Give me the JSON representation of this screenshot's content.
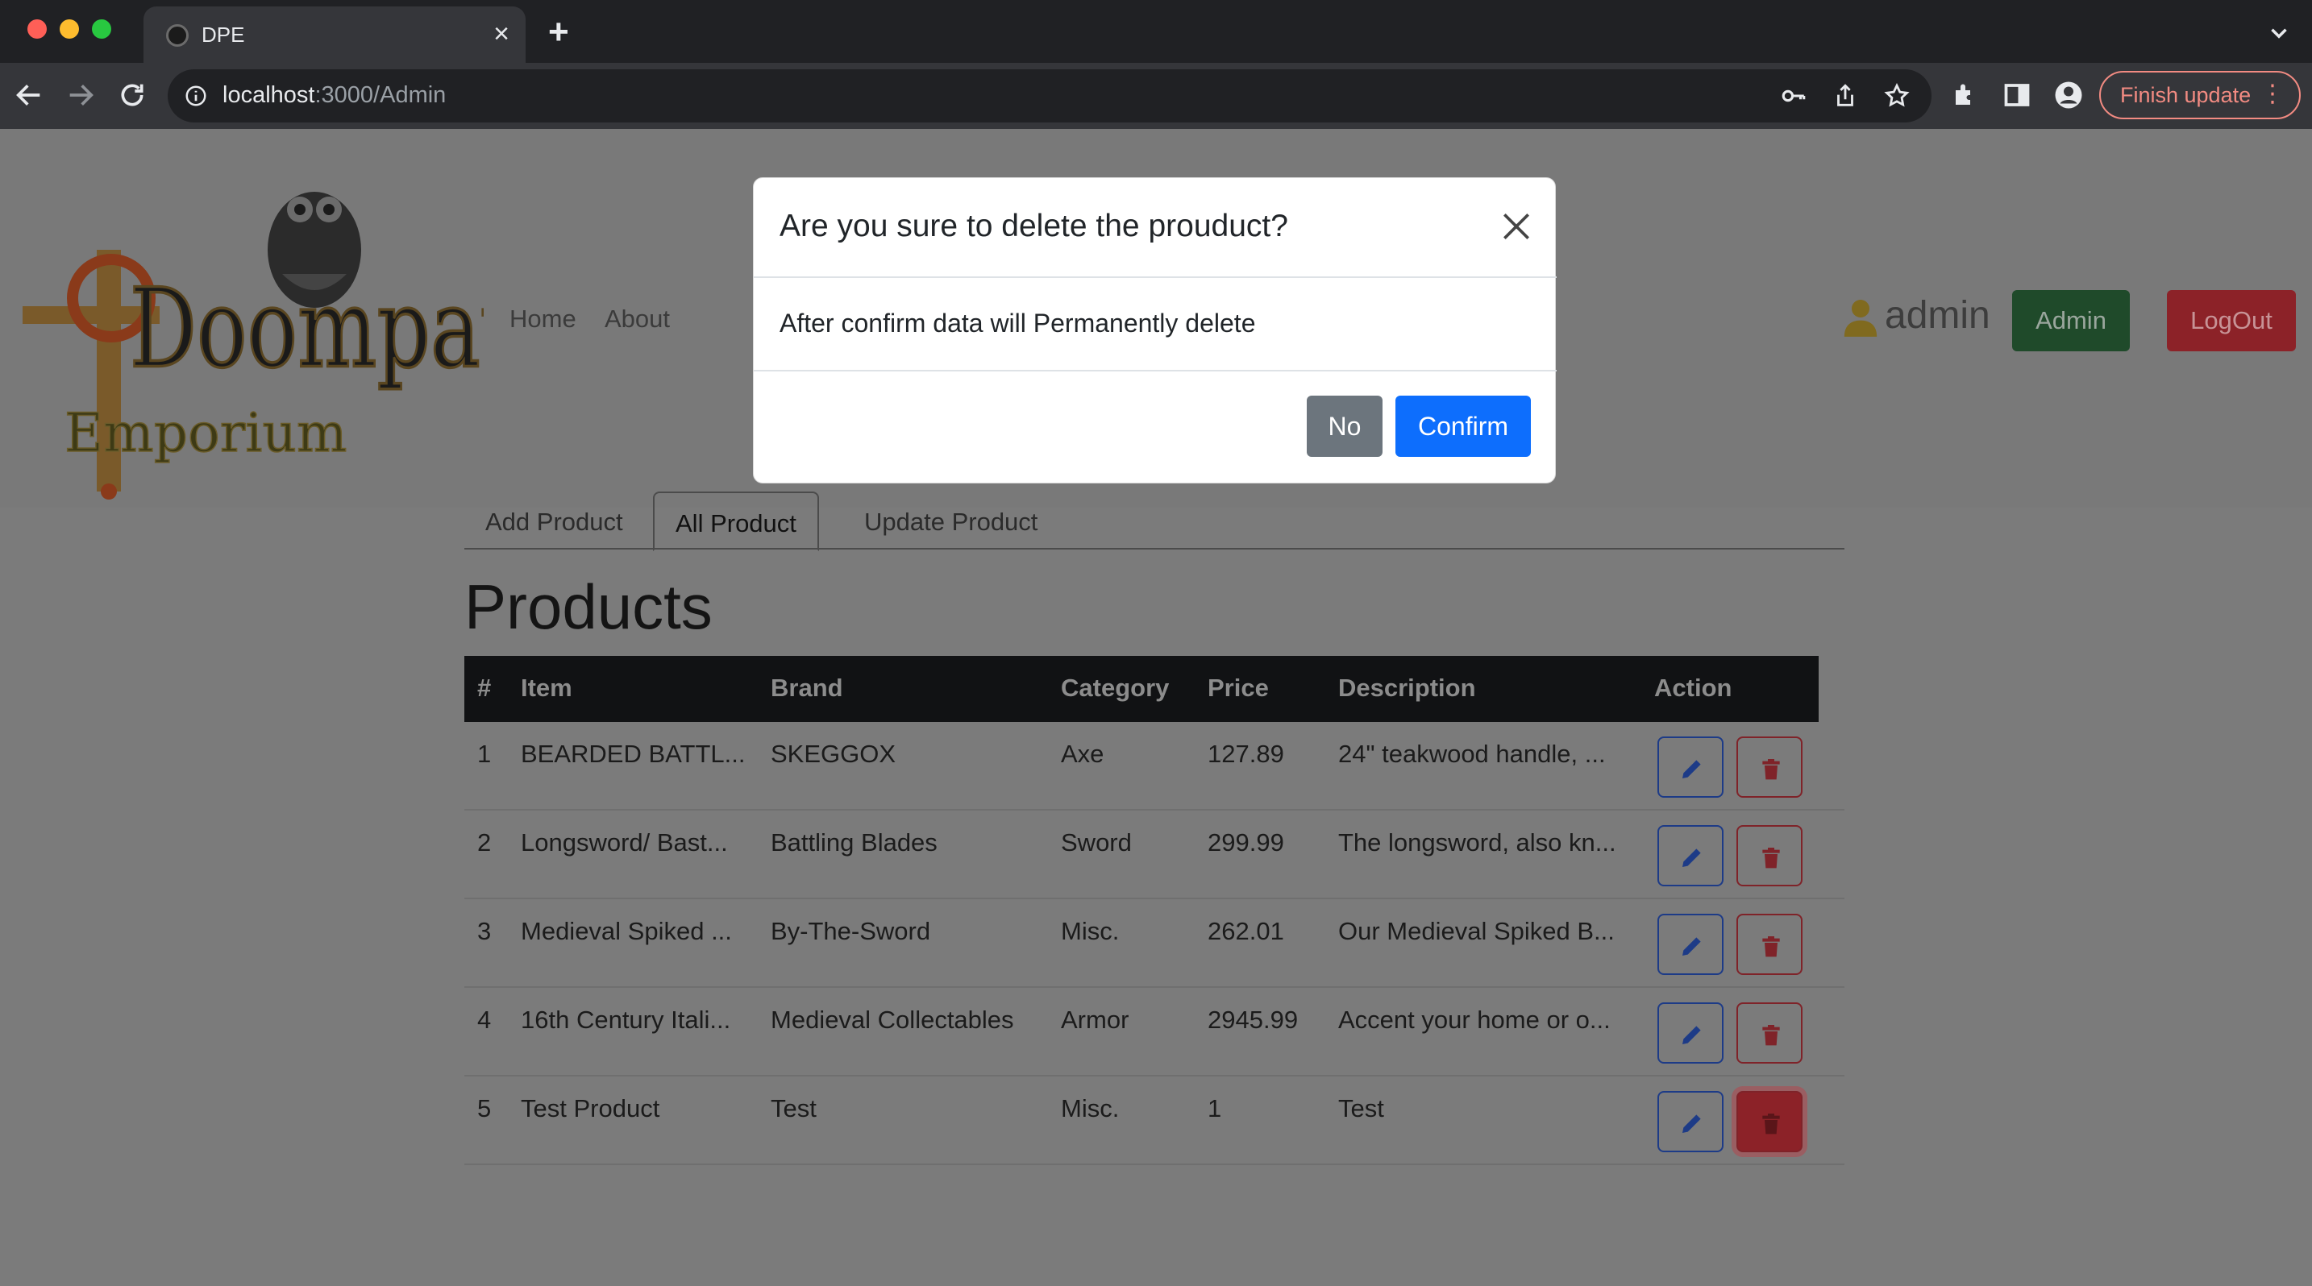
{
  "browser": {
    "tab_title": "DPE",
    "tab_close": "×",
    "new_tab": "+",
    "url_host": "localhost",
    "url_path": ":3000/Admin",
    "finish_update_label": "Finish update",
    "menu_dots": "⋮",
    "icons": [
      "back-icon",
      "forward-icon",
      "reload-icon",
      "info-icon",
      "key-icon",
      "share-icon",
      "star-icon",
      "extensions-icon",
      "sidepanel-icon",
      "profile-icon"
    ]
  },
  "site": {
    "logo_lines": [
      "Doompause",
      "Emporium"
    ],
    "nav": {
      "home": "Home",
      "about": "About"
    },
    "username": "admin",
    "admin_button": "Admin",
    "logout_button": "LogOut"
  },
  "admin_tabs": [
    {
      "label": "Add Product",
      "active": false
    },
    {
      "label": "All Product",
      "active": true
    },
    {
      "label": "Update Product",
      "active": false
    }
  ],
  "heading": "Products",
  "table": {
    "headers": [
      "#",
      "Item",
      "Brand",
      "Category",
      "Price",
      "Description",
      "Action"
    ],
    "rows": [
      {
        "num": "1",
        "item": "BEARDED BATTL...",
        "brand": "SKEGGOX",
        "category": "Axe",
        "price": "127.89",
        "description": "24\" teakwood handle, ..."
      },
      {
        "num": "2",
        "item": "Longsword/ Bast...",
        "brand": "Battling Blades",
        "category": "Sword",
        "price": "299.99",
        "description": "The longsword, also kn..."
      },
      {
        "num": "3",
        "item": "Medieval Spiked ...",
        "brand": "By-The-Sword",
        "category": "Misc.",
        "price": "262.01",
        "description": "Our Medieval Spiked B..."
      },
      {
        "num": "4",
        "item": "16th Century Itali...",
        "brand": "Medieval Collectables",
        "category": "Armor",
        "price": "2945.99",
        "description": "Accent your home or o..."
      },
      {
        "num": "5",
        "item": "Test Product",
        "brand": "Test",
        "category": "Misc.",
        "price": "1",
        "description": "Test"
      }
    ]
  },
  "modal": {
    "title": "Are you sure to delete the prouduct?",
    "body": "After confirm data will Permanently delete",
    "no_label": "No",
    "confirm_label": "Confirm"
  },
  "colors": {
    "primary": "#0d6efd",
    "secondary": "#6c757d",
    "danger": "#dc3545",
    "success": "#198754",
    "backdrop": "#7b7b7b"
  }
}
